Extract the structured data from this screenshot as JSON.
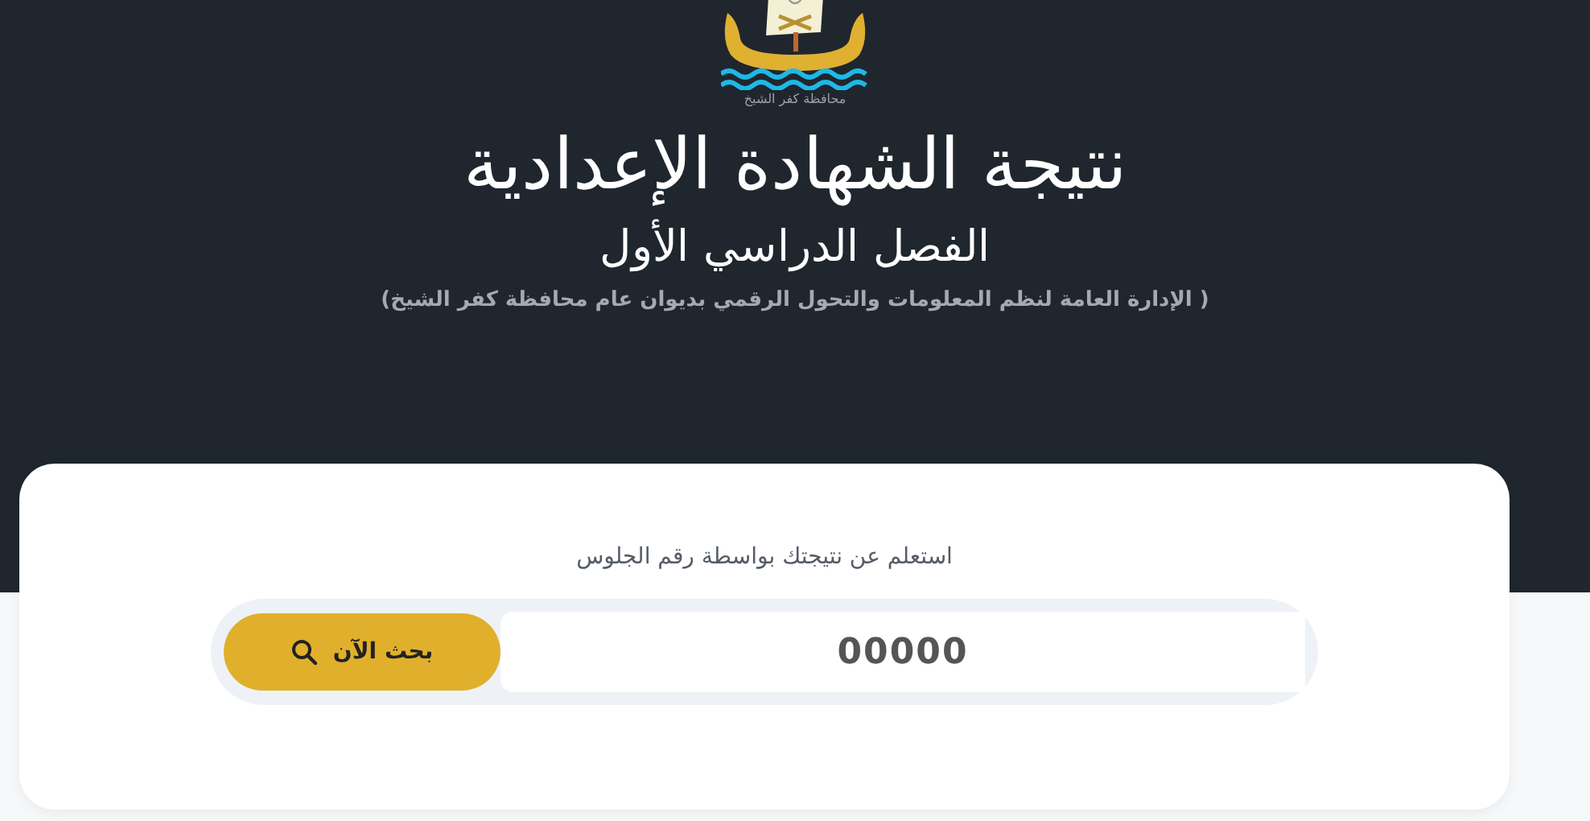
{
  "logo": {
    "caption": "محافظة كفر الشيخ"
  },
  "header": {
    "title": "نتيجة الشهادة الإعدادية",
    "subtitle": "الفصل الدراسي الأول",
    "note": "( الإدارة العامة لنظم المعلومات والتحول الرقمي بديوان عام محافظة كفر الشيخ)"
  },
  "search": {
    "label": "استعلم عن نتيجتك بواسطة رقم الجلوس",
    "value": "00000",
    "button": "بحث الآن"
  }
}
